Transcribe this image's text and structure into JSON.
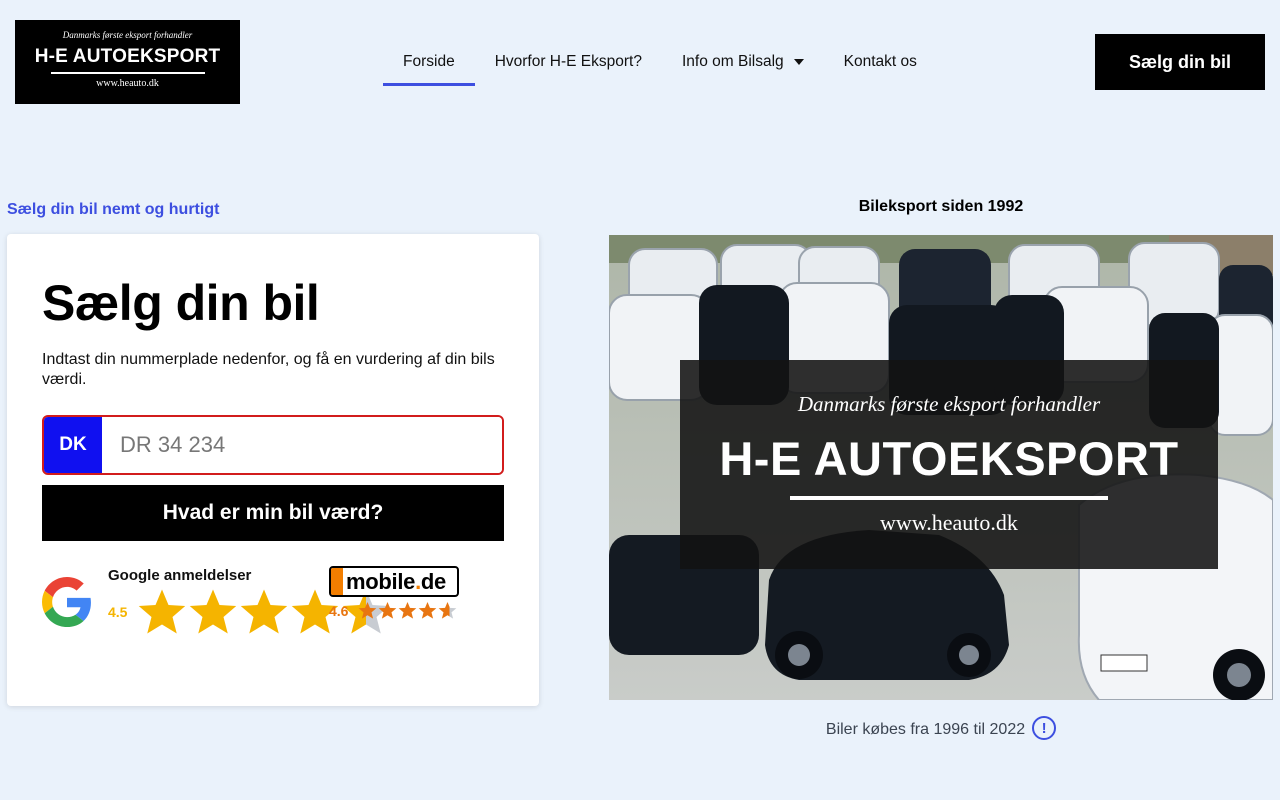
{
  "logo": {
    "tagline": "Danmarks første eksport forhandler",
    "name": "H-E AUTOEKSPORT",
    "url": "www.heauto.dk"
  },
  "nav": {
    "items": [
      {
        "label": "Forside"
      },
      {
        "label": "Hvorfor H-E Eksport?"
      },
      {
        "label": "Info om Bilsalg"
      },
      {
        "label": "Kontakt os"
      }
    ]
  },
  "header": {
    "sell_button": "Sælg din bil"
  },
  "left": {
    "subtitle": "Sælg din bil nemt og hurtigt",
    "card": {
      "title": "Sælg din bil",
      "description": "Indtast din nummerplade nedenfor, og få en vurdering af din bils værdi.",
      "plate_country": "DK",
      "plate_placeholder": "DR 34 234",
      "submit_label": "Hvad er min bil værd?"
    },
    "google_review": {
      "title": "Google anmeldelser",
      "rating": "4.5",
      "stars": 4.5
    },
    "mobile_review": {
      "brand_main": "mobile",
      "brand_dot": ".",
      "brand_tld": "de",
      "rating": "4.6",
      "stars": 4.6
    }
  },
  "right": {
    "heading": "Bileksport siden 1992",
    "banner": {
      "tagline": "Danmarks første eksport forhandler",
      "name": "H-E AUTOEKSPORT",
      "url": "www.heauto.dk"
    },
    "caption": "Biler købes fra 1996 til 2022",
    "info_symbol": "!"
  },
  "colors": {
    "accent": "#3d4fe0",
    "star_google": "#f5b400",
    "star_mobile": "#e87511",
    "plate_blue": "#1010f0",
    "plate_border": "#d21c1c"
  }
}
